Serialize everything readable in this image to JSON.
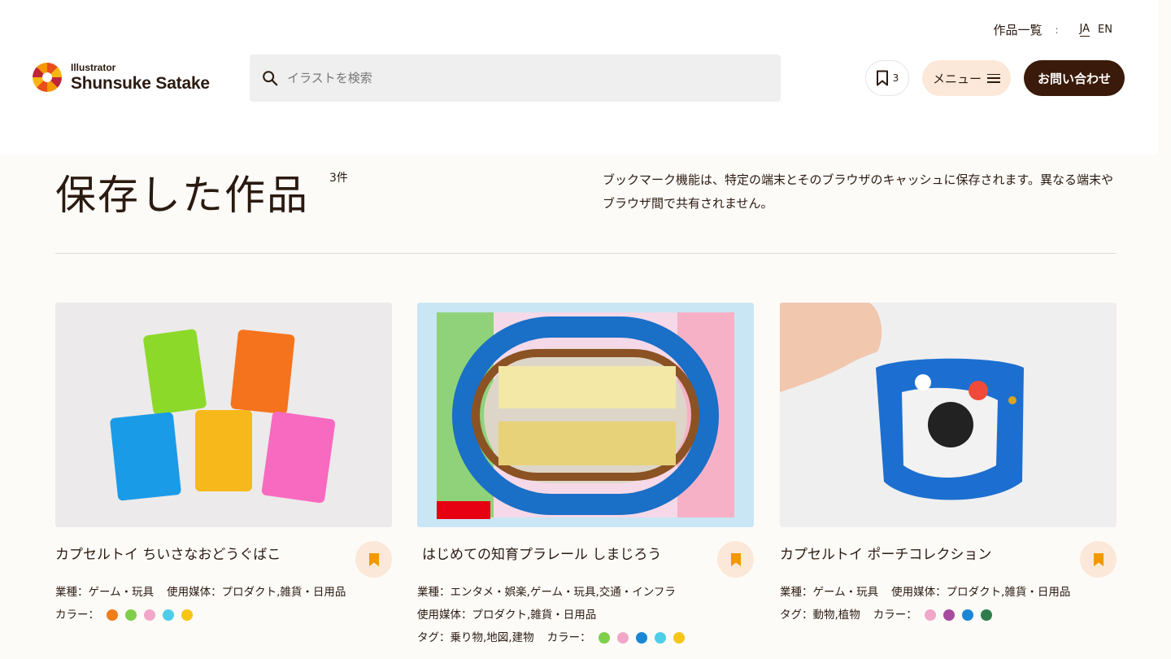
{
  "header": {
    "top_nav": {
      "works": "作品一覧",
      "separator": ":",
      "lang_ja": "JA",
      "lang_en": "EN"
    },
    "logo": {
      "sub": "Illustrator",
      "main": "Shunsuke Satake"
    },
    "search": {
      "placeholder": "イラストを検索",
      "icon": "search-icon"
    },
    "bookmark_count": "3",
    "menu_label": "メニュー",
    "contact_label": "お問い合わせ"
  },
  "page": {
    "title": "保存した作品",
    "count": "3件",
    "note": "ブックマーク機能は、特定の端末とそのブラウザのキャッシュに保存されます。異なる端末やブラウザ間で共有されません。"
  },
  "colors": {
    "accent": "#f39800",
    "dark_brown": "#3a1a0a",
    "peach": "#fbe8d8"
  },
  "cards": [
    {
      "title": "カプセルトイ ちいさなおどうぐばこ",
      "industry": "業種：ゲーム・玩具",
      "media": "使用媒体：プロダクト,雑貨・日用品",
      "color_label": "カラー：",
      "colors": [
        "#f07d1b",
        "#7ecf4a",
        "#f2a7c8",
        "#4fcde8",
        "#f7c514"
      ]
    },
    {
      "title": "はじめての知育プラレール しまじろう",
      "industry": "業種：エンタメ・娯楽,ゲーム・玩具,交通・インフラ",
      "media": "使用媒体：プロダクト,雑貨・日用品",
      "tags": "タグ：乗り物,地図,建物",
      "color_label": "カラー：",
      "colors": [
        "#7ecf4a",
        "#f2a7c8",
        "#1a86d6",
        "#4fcde8",
        "#f7c514"
      ]
    },
    {
      "title": "カプセルトイ ポーチコレクション",
      "industry": "業種：ゲーム・玩具",
      "media": "使用媒体：プロダクト,雑貨・日用品",
      "tags": "タグ：動物,植物",
      "color_label": "カラー：",
      "colors": [
        "#f2a7c8",
        "#a64a9e",
        "#1a86d6",
        "#2f7d4a"
      ]
    }
  ]
}
